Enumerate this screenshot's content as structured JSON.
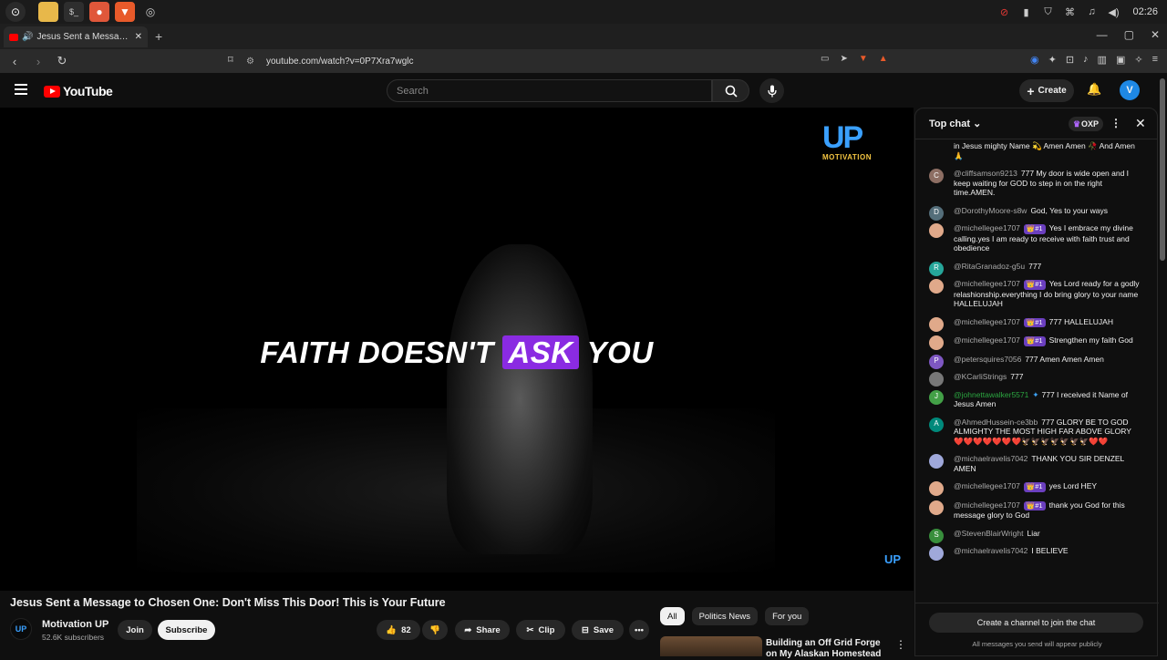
{
  "taskbar": {
    "clock": "02:26"
  },
  "browser": {
    "tab_title": "Jesus Sent a Message to C",
    "url": "youtube.com/watch?v=0P7Xra7wglc",
    "new_tab": "+"
  },
  "youtube": {
    "logo": "YouTube",
    "search_placeholder": "Search",
    "create_label": "Create",
    "avatar_letter": "V"
  },
  "video": {
    "caption_pre": "FAITH DOESN'T ",
    "caption_hl": "ASK",
    "caption_post": " YOU",
    "watermark_up": "UP",
    "watermark_motivation": "MOTIVATION",
    "watermark_small": "UP",
    "title": "Jesus Sent a Message to Chosen One: Don't Miss This Door! This is Your Future",
    "channel": "Motivation UP",
    "subscribers": "52.6K subscribers",
    "channel_avatar": "UP",
    "join": "Join",
    "subscribe": "Subscribe",
    "likes": "82",
    "share": "Share",
    "clip": "Clip",
    "save": "Save"
  },
  "chips": [
    "All",
    "Politics News",
    "For you"
  ],
  "recommendation": {
    "title": "Building an Off Grid Forge on My Alaskan Homestead"
  },
  "chat": {
    "header": "Top chat",
    "oxp": "OXP",
    "create_channel": "Create a channel to join the chat",
    "public_note": "All messages you send will appear publicly",
    "messages": [
      {
        "author": "",
        "text": "in Jesus mighty Name 💫 Amen Amen 🥀 And Amen 🙏",
        "av": "",
        "color": ""
      },
      {
        "author": "@cliffsamson9213",
        "text": "777 My door is wide open and I keep waiting for GOD to step in on the right time.AMEN.",
        "av": "C",
        "color": "#8d6e63"
      },
      {
        "author": "@DorothyMoore-s8w",
        "text": "God, Yes to your ways",
        "av": "D",
        "color": "#546e7a"
      },
      {
        "author": "@michellegee1707",
        "badge": "👑#1",
        "text": "Yes I embrace my divine calling.yes I am ready to receive with faith trust and obedience",
        "av": "",
        "color": "#e0a98a"
      },
      {
        "author": "@RitaGranadoz-g5u",
        "text": "777",
        "av": "R",
        "color": "#26a69a"
      },
      {
        "author": "@michellegee1707",
        "badge": "👑#1",
        "text": "Yes Lord ready for a godly relashionship.everything I do bring glory to your name HALLELUJAH",
        "av": "",
        "color": "#e0a98a"
      },
      {
        "author": "@michellegee1707",
        "badge": "👑#1",
        "text": "777 HALLELUJAH",
        "av": "",
        "color": "#e0a98a"
      },
      {
        "author": "@michellegee1707",
        "badge": "👑#1",
        "text": "Strengthen my faith God",
        "av": "",
        "color": "#e0a98a"
      },
      {
        "author": "@petersquires7056",
        "text": "777 Amen Amen Amen",
        "av": "P",
        "color": "#7e57c2"
      },
      {
        "author": "@KCarliStrings",
        "text": "777",
        "av": "",
        "color": "#777777"
      },
      {
        "author": "@johnettawalker5571",
        "verified": "✦",
        "text": "777 I received it Name of Jesus Amen",
        "av": "J",
        "color": "#43a047",
        "author_color": "#2ba640"
      },
      {
        "author": "@AhmedHussein-ce3bb",
        "text": "777 GLORY BE TO GOD ALMIGHTY THE MOST HIGH FAR ABOVE GLORY ❤️❤️❤️❤️❤️❤️❤️🦅🦅🦅🦅🦅🦅🦅❤️❤️",
        "av": "A",
        "color": "#00897b"
      },
      {
        "author": "@michaelravelis7042",
        "text": "THANK YOU SIR DENZEL AMEN",
        "av": "",
        "color": "#9fa8da"
      },
      {
        "author": "@michellegee1707",
        "badge": "👑#1",
        "text": "yes Lord HEY",
        "av": "",
        "color": "#e0a98a"
      },
      {
        "author": "@michellegee1707",
        "badge": "👑#1",
        "text": "thank you God for this message glory to God",
        "av": "",
        "color": "#e0a98a"
      },
      {
        "author": "@StevenBlairWright",
        "text": "Liar",
        "av": "S",
        "color": "#388e3c"
      },
      {
        "author": "@michaelravelis7042",
        "text": "I BELIEVE",
        "av": "",
        "color": "#9fa8da"
      }
    ]
  }
}
